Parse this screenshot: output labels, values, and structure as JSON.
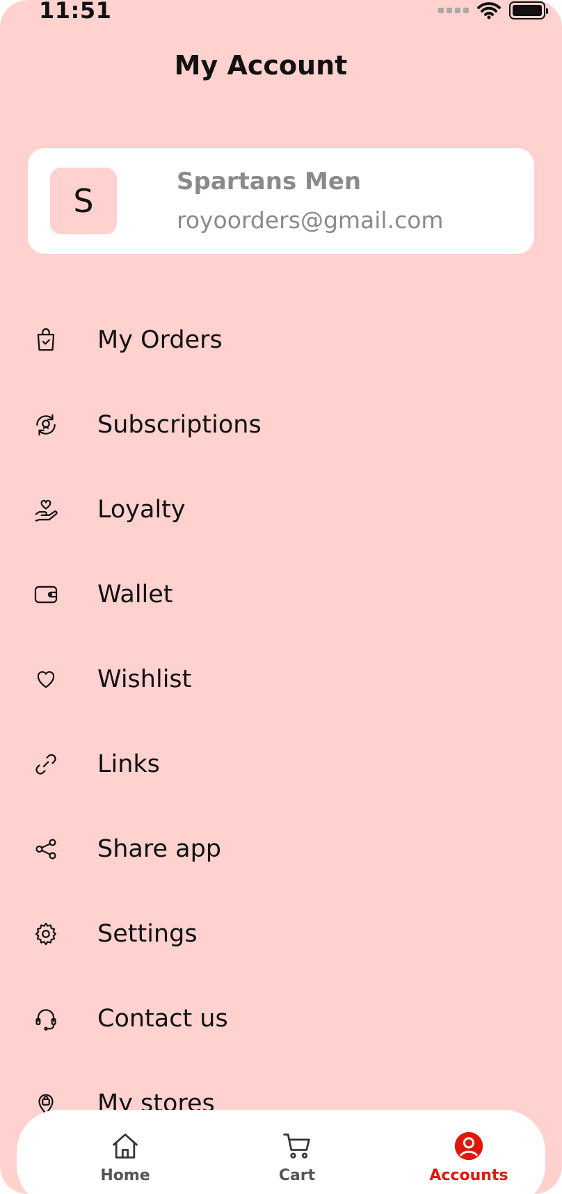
{
  "status_bar": {
    "time": "11:51"
  },
  "header": {
    "title": "My Account"
  },
  "profile": {
    "initial": "S",
    "name": "Spartans Men",
    "email": "royoorders@gmail.com"
  },
  "menu": {
    "items": [
      {
        "label": "My Orders",
        "icon": "shopping-bag-icon"
      },
      {
        "label": "Subscriptions",
        "icon": "subscription-icon"
      },
      {
        "label": "Loyalty",
        "icon": "hand-heart-icon"
      },
      {
        "label": "Wallet",
        "icon": "wallet-icon"
      },
      {
        "label": "Wishlist",
        "icon": "heart-icon"
      },
      {
        "label": "Links",
        "icon": "link-icon"
      },
      {
        "label": "Share app",
        "icon": "share-icon"
      },
      {
        "label": "Settings",
        "icon": "gear-icon"
      },
      {
        "label": "Contact us",
        "icon": "headset-icon"
      },
      {
        "label": "My stores",
        "icon": "store-pin-icon"
      }
    ]
  },
  "bottom_nav": {
    "items": [
      {
        "label": "Home",
        "icon": "home-icon",
        "active": false
      },
      {
        "label": "Cart",
        "icon": "cart-icon",
        "active": false
      },
      {
        "label": "Accounts",
        "icon": "account-icon",
        "active": true
      }
    ]
  },
  "colors": {
    "background": "#ffd1cf",
    "card": "#ffffff",
    "accent": "#e0180c",
    "muted_text": "#8a8a8a"
  }
}
